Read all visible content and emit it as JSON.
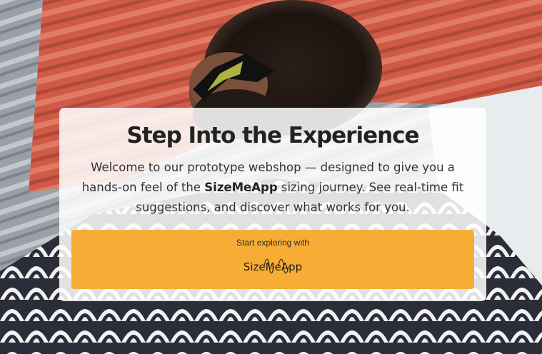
{
  "hero": {
    "title": "Step Into the Experience",
    "intro_before": "Welcome to our prototype webshop — designed to give you a hands-on feel of the ",
    "intro_brand": "SizeMeApp",
    "intro_after": " sizing journey. See real-time fit suggestions, and discover what works for you.",
    "cta": {
      "label": "Start exploring with",
      "logo_part1": "Size",
      "logo_part2": "Me",
      "logo_part3": "App"
    }
  },
  "colors": {
    "cta_background": "#f7ad35",
    "card_background": "#ffffff",
    "title_color": "#222222"
  }
}
